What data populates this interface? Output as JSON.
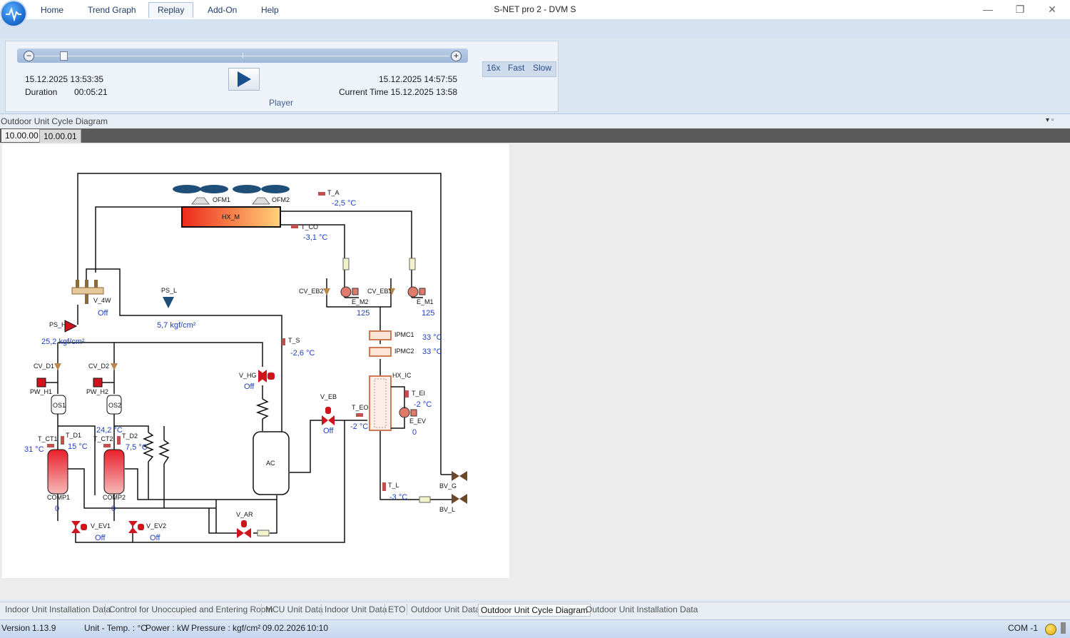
{
  "app": {
    "title": "S-NET pro 2 - DVM S",
    "window_controls": {
      "minimize": "—",
      "restore": "❐",
      "close": "✕"
    }
  },
  "menu": {
    "tabs": [
      "Home",
      "Trend Graph",
      "Replay",
      "Add-On",
      "Help"
    ],
    "active": "Replay"
  },
  "player": {
    "start_time": "15.12.2025 13:53:35",
    "duration_label": "Duration",
    "duration": "00:05:21",
    "end_time": "15.12.2025 14:57:55",
    "current_time": "Current Time 15.12.2025 13:58",
    "group_label": "Player",
    "zoom_out": "−",
    "zoom_in": "+",
    "position_fraction": 0.07,
    "speed_buttons": [
      "16x",
      "Fast",
      "Slow"
    ]
  },
  "panel": {
    "title": "Outdoor Unit Cycle Diagram",
    "unit_tabs": [
      "10.00.00",
      "10.00.01"
    ],
    "pin_icon": "▾ ▫"
  },
  "diagram": {
    "labels": {
      "ofm1": "OFM1",
      "ofm2": "OFM2",
      "hx_m": "HX_M",
      "t_a": "T_A",
      "t_a_val": "-2,5 °C",
      "t_co": "T_CO",
      "t_co_val": "-3,1 °C",
      "v_4w": "V_4W",
      "v_4w_val": "Off",
      "ps_l": "PS_L",
      "ps_l_val": "5,7 kgf/cm²",
      "ps_h": "PS_H",
      "ps_h_val": "25,2 kgf/cm²",
      "cv_eb2": "CV_EB2",
      "cv_eb1": "CV_EB1",
      "e_m2": "E_M2",
      "e_m2_val": "125",
      "e_m1": "E_M1",
      "e_m1_val": "125",
      "ipmc1": "IPMC1",
      "ipmc1_val": "33 °C",
      "ipmc2": "IPMC2",
      "ipmc2_val": "33 °C",
      "t_s": "T_S",
      "t_s_val": "-2,6 °C",
      "v_hg": "V_HG",
      "v_hg_val": "Off",
      "hx_ic": "HX_IC",
      "t_ei": "T_EI",
      "t_ei_val": "-2 °C",
      "e_ev": "E_EV",
      "e_ev_val": "0",
      "v_eb": "V_EB",
      "v_eb_val": "Off",
      "t_eo": "T_EO",
      "t_eo_val": "-2 °C",
      "cv_d1": "CV_D1",
      "cv_d2": "CV_D2",
      "pw_h1": "PW_H1",
      "pw_h2": "PW_H2",
      "os1": "OS1",
      "os2": "OS2",
      "t_ct1": "T_CT1",
      "t_ct1_val": "31 °C",
      "t_d1": "T_D1",
      "t_d1_val": "15 °C",
      "t_ct2": "T_CT2",
      "t_d2": "T_D2",
      "t_d2_val": "7,5 °C",
      "t_d2_top_val": "24,2 °C",
      "comp1": "COMP1",
      "comp1_val": "0",
      "comp2": "COMP2",
      "comp2_val": "0",
      "ac": "AC",
      "v_ar": "V_AR",
      "v_ev1": "V_EV1",
      "v_ev1_val": "Off",
      "v_ev2": "V_EV2",
      "v_ev2_val": "Off",
      "t_l": "T_L",
      "t_l_val": "-3 °C",
      "bv_g": "BV_G",
      "bv_l": "BV_L"
    },
    "colors": {
      "pipe": "#111111",
      "valve": "#d0141d",
      "sensor": "#c0504d",
      "value": "#1e3fbf"
    }
  },
  "bottom_tabs": {
    "items": [
      "Indoor Unit Installation Data",
      "Control for Unoccupied and Entering Room",
      "MCU Unit Data",
      "Indoor Unit Data",
      "ETO",
      "Outdoor Unit Data",
      "Outdoor Unit Cycle Diagram",
      "Outdoor Unit Installation Data"
    ],
    "active": "Outdoor Unit Cycle Diagram"
  },
  "status": {
    "version_label": "Version",
    "version": "1.13.9",
    "temp_unit": "Unit - Temp. : °C",
    "power_unit": "Power : kW",
    "pressure_unit": "Pressure :  kgf/cm²",
    "date": "09.02.2026",
    "time": "10:10",
    "com": "COM -1"
  }
}
